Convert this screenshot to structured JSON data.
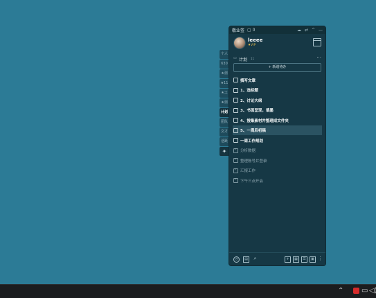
{
  "window": {
    "title": "敬业签",
    "count": "0",
    "title_icons": [
      "cloud-icon",
      "sync-icon",
      "collapse-icon",
      "minimize-icon"
    ]
  },
  "user": {
    "name": "leeee",
    "badge": "VIP"
  },
  "side_tabs": [
    "个人",
    "630",
    "★测",
    "★11",
    "★工",
    "★测",
    "计划",
    "团队",
    "文才",
    "活跃"
  ],
  "active_tab": "计划",
  "section": {
    "label": "计划",
    "count": "11",
    "more": "···"
  },
  "add_button": "+ 新增待办",
  "tasks": [
    {
      "text": "撰写文章",
      "done": false
    },
    {
      "text": "1、选标题",
      "done": false
    },
    {
      "text": "2、讨论大纲",
      "done": false
    },
    {
      "text": "3、书面呈现，填墨",
      "done": false
    },
    {
      "text": "4、搜集素材并整理成文件夹",
      "done": false
    },
    {
      "text": "5、一周后初稿",
      "done": false,
      "selected": true
    },
    {
      "text": "一周工作规划",
      "done": false
    },
    {
      "text": "分析数据",
      "done": true
    },
    {
      "text": "整理账号并登录",
      "done": true
    },
    {
      "text": "汇报工作",
      "done": true
    },
    {
      "text": "下午三点开会",
      "done": true
    }
  ],
  "bottom": {
    "left_icons": [
      "clock-icon",
      "calendar-icon",
      "search-icon"
    ],
    "right_icons": [
      "add-icon",
      "grid-icon",
      "list-icon",
      "note-icon",
      "more-icon"
    ]
  },
  "colors": {
    "desktop": "#2c7b96",
    "widget_bg": "#163845",
    "selected_row": "#2b5362",
    "vip": "#e3b84a"
  }
}
